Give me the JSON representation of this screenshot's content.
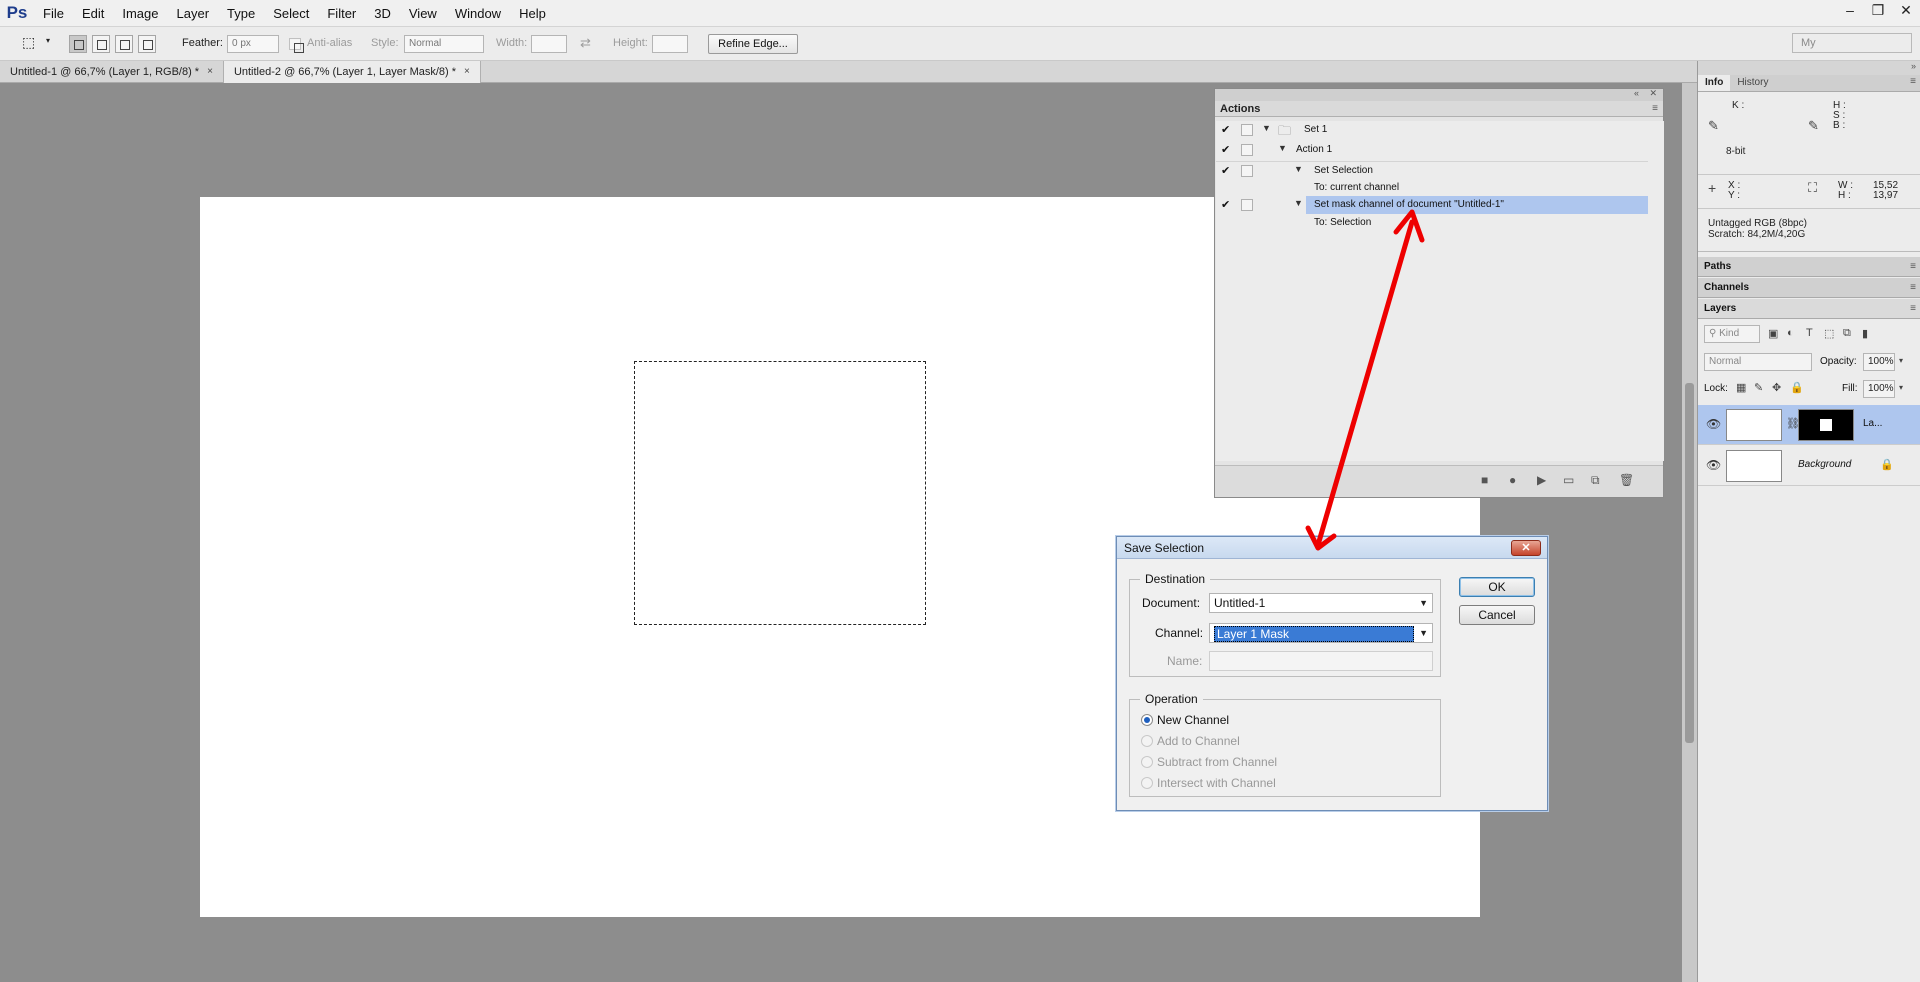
{
  "app": {
    "logo": "Ps"
  },
  "menu": [
    "File",
    "Edit",
    "Image",
    "Layer",
    "Type",
    "Select",
    "Filter",
    "3D",
    "View",
    "Window",
    "Help"
  ],
  "window_controls": {
    "minimize": "–",
    "restore": "❐",
    "close": "✕"
  },
  "workspace": "My",
  "options": {
    "feather_label": "Feather:",
    "feather_value": "0 px",
    "antialias_label": "Anti-alias",
    "style_label": "Style:",
    "style_value": "Normal",
    "width_label": "Width:",
    "height_label": "Height:",
    "refine_edge": "Refine Edge..."
  },
  "tabs": [
    {
      "label": "Untitled-1 @ 66,7% (Layer 1, RGB/8) *",
      "close": "×"
    },
    {
      "label": "Untitled-2 @ 66,7% (Layer 1, Layer Mask/8) *",
      "close": "×"
    }
  ],
  "actions": {
    "title": "Actions",
    "rows": [
      {
        "check": "✔",
        "toggle": "▼",
        "label": "Set 1"
      },
      {
        "check": "✔",
        "toggle": "▼",
        "label": "Action 1"
      },
      {
        "check": "✔",
        "toggle": "▼",
        "label": "Set Selection"
      },
      {
        "check": "",
        "toggle": "",
        "label": "To: current channel"
      },
      {
        "check": "✔",
        "toggle": "▼",
        "label": "Set mask channel of document \"Untitled-1\""
      },
      {
        "check": "",
        "toggle": "",
        "label": "To: Selection"
      }
    ]
  },
  "info": {
    "tabs": [
      "Info",
      "History"
    ],
    "k": "K :",
    "h": "H :",
    "s": "S :",
    "b": "B :",
    "bitdepth": "8-bit",
    "x": "X :",
    "y": "Y :",
    "w_label": "W :",
    "w_value": "15,52",
    "h_label": "H :",
    "h_value": "13,97",
    "profile": "Untagged RGB (8bpc)",
    "scratch": "Scratch: 84,2M/4,20G"
  },
  "panels": {
    "paths": "Paths",
    "channels": "Channels",
    "layers": "Layers"
  },
  "layers": {
    "kind": "Kind",
    "blend": "Normal",
    "opacity_label": "Opacity:",
    "opacity_value": "100%",
    "lock_label": "Lock:",
    "fill_label": "Fill:",
    "fill_value": "100%",
    "items": [
      {
        "name": "La..."
      },
      {
        "name": "Background"
      }
    ]
  },
  "dialog": {
    "title": "Save Selection",
    "close": "✕",
    "destination": "Destination",
    "document_label": "Document:",
    "document_value": "Untitled-1",
    "channel_label": "Channel:",
    "channel_value": "Layer 1 Mask",
    "name_label": "Name:",
    "operation": "Operation",
    "ops": [
      "New Channel",
      "Add to Channel",
      "Subtract from Channel",
      "Intersect with Channel"
    ],
    "ok": "OK",
    "cancel": "Cancel"
  },
  "colors": {
    "annotation_arrow": "#ee0000",
    "selection": "#aec6ee"
  }
}
